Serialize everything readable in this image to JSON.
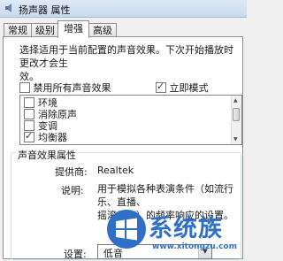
{
  "window": {
    "title": "扬声器 属性"
  },
  "tabs": [
    {
      "label": "常规"
    },
    {
      "label": "级别"
    },
    {
      "label": "增强"
    },
    {
      "label": "高级"
    }
  ],
  "active_tab": "增强",
  "description": {
    "line1": "选择适用于当前配置的声音效果。下次开始播放时更改才会生",
    "line2": "效。"
  },
  "options": {
    "disable_all": {
      "label": "禁用所有声音效果",
      "checked": false
    },
    "immediate_mode": {
      "label": "立即模式",
      "checked": true
    }
  },
  "effects": [
    {
      "label": "环境",
      "checked": false
    },
    {
      "label": "消除原声",
      "checked": false
    },
    {
      "label": "变调",
      "checked": false
    },
    {
      "label": "均衡器",
      "checked": true
    }
  ],
  "properties": {
    "group_label": "声音效果属性",
    "provider_label": "提供商:",
    "provider_value": "Realtek",
    "desc_label": "说明:",
    "desc_line1": "用于模拟各种表演条件（如流行乐、直播、",
    "desc_line2": "摇滚乐等）的频率响应的设置。",
    "setting_label": "设置:",
    "setting_value": "低音"
  },
  "watermark": {
    "brand": "系统族",
    "url": "www.xitongzu.com"
  },
  "colors": {
    "accent": "#2f6fc8",
    "tab_border": "#8e8f8f"
  }
}
